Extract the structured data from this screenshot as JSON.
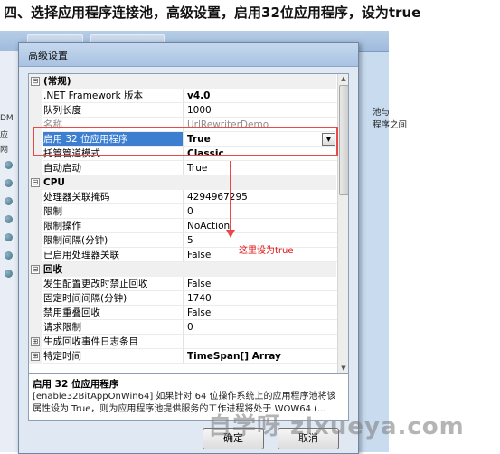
{
  "heading": "四、选择应用程序连接池，高级设置，启用32位应用程序，设为true",
  "background": {
    "left_labels": [
      "DM",
      "应",
      "网"
    ],
    "right_text": [
      "池与",
      "程序之间"
    ]
  },
  "dialog": {
    "title": "高级设置",
    "rows": [
      {
        "type": "category",
        "toggle": "⊟",
        "name": "(常规)"
      },
      {
        "type": "prop",
        "name": ".NET Framework 版本",
        "value": "v4.0",
        "bold": true
      },
      {
        "type": "prop",
        "name": "队列长度",
        "value": "1000"
      },
      {
        "type": "prop",
        "name": "名称",
        "value": "UrlRewriterDemo",
        "gray": true
      },
      {
        "type": "prop",
        "name": "启用 32 位应用程序",
        "value": "True",
        "bold": true,
        "selected": true
      },
      {
        "type": "prop",
        "name": "托管管道模式",
        "value": "Classic",
        "bold": true
      },
      {
        "type": "prop",
        "name": "自动启动",
        "value": "True"
      },
      {
        "type": "category",
        "toggle": "⊟",
        "name": "CPU"
      },
      {
        "type": "prop",
        "name": "处理器关联掩码",
        "value": "4294967295"
      },
      {
        "type": "prop",
        "name": "限制",
        "value": "0"
      },
      {
        "type": "prop",
        "name": "限制操作",
        "value": "NoAction"
      },
      {
        "type": "prop",
        "name": "限制间隔(分钟)",
        "value": "5"
      },
      {
        "type": "prop",
        "name": "已启用处理器关联",
        "value": "False"
      },
      {
        "type": "category",
        "toggle": "⊟",
        "name": "回收"
      },
      {
        "type": "prop",
        "name": "发生配置更改时禁止回收",
        "value": "False"
      },
      {
        "type": "prop",
        "name": "固定时间间隔(分钟)",
        "value": "1740"
      },
      {
        "type": "prop",
        "name": "禁用重叠回收",
        "value": "False"
      },
      {
        "type": "prop",
        "name": "请求限制",
        "value": "0"
      },
      {
        "type": "sub",
        "toggle": "⊞",
        "name": "生成回收事件日志条目",
        "value": ""
      },
      {
        "type": "sub",
        "toggle": "⊞",
        "name": "特定时间",
        "value": "TimeSpan[] Array",
        "bold": true
      }
    ],
    "description": {
      "title": "启用 32 位应用程序",
      "text": "[enable32BitAppOnWin64] 如果针对 64 位操作系统上的应用程序池将该属性设为 True，则为应用程序池提供服务的工作进程将处于 WOW64 (..."
    },
    "ok_label": "确定",
    "cancel_label": "取消"
  },
  "annotation": "这里设为true",
  "watermark": "自学呀 zixueya.com",
  "colors": {
    "highlight": "#e84a4a",
    "selection": "#3c7fd1"
  }
}
